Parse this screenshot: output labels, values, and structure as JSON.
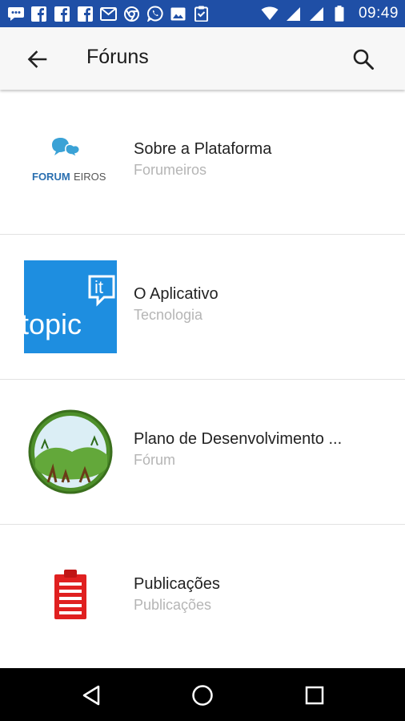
{
  "status_bar": {
    "time": "09:49",
    "left_icons": [
      "message-icon",
      "facebook-icon",
      "facebook-icon",
      "facebook-icon",
      "gmail-icon",
      "chrome-icon",
      "whatsapp-icon",
      "image-icon",
      "clipboard-icon"
    ],
    "right_icons": [
      "wifi-icon",
      "signal-icon",
      "signal-icon",
      "battery-icon"
    ],
    "color": "#1f4fa6"
  },
  "app_bar": {
    "title": "Fóruns",
    "back_icon": "arrow-back-icon",
    "search_icon": "search-icon"
  },
  "forums": [
    {
      "title": "Sobre a Plataforma",
      "subtitle": "Forumeiros",
      "logo": "forumeiros-logo",
      "logo_text_a": "FORUM",
      "logo_text_b": "EIROS"
    },
    {
      "title": "O Aplicativo",
      "subtitle": "Tecnologia",
      "logo": "topic-it-logo",
      "logo_text_a": "topic",
      "logo_text_b": "it"
    },
    {
      "title": "Plano de Desenvolvimento ...",
      "subtitle": "Fórum",
      "logo": "green-circle-logo"
    },
    {
      "title": "Publicações",
      "subtitle": "Publicações",
      "logo": "clipboard-logo"
    }
  ],
  "nav_bar": {
    "back": "nav-back-icon",
    "home": "nav-home-icon",
    "recents": "nav-recents-icon"
  }
}
